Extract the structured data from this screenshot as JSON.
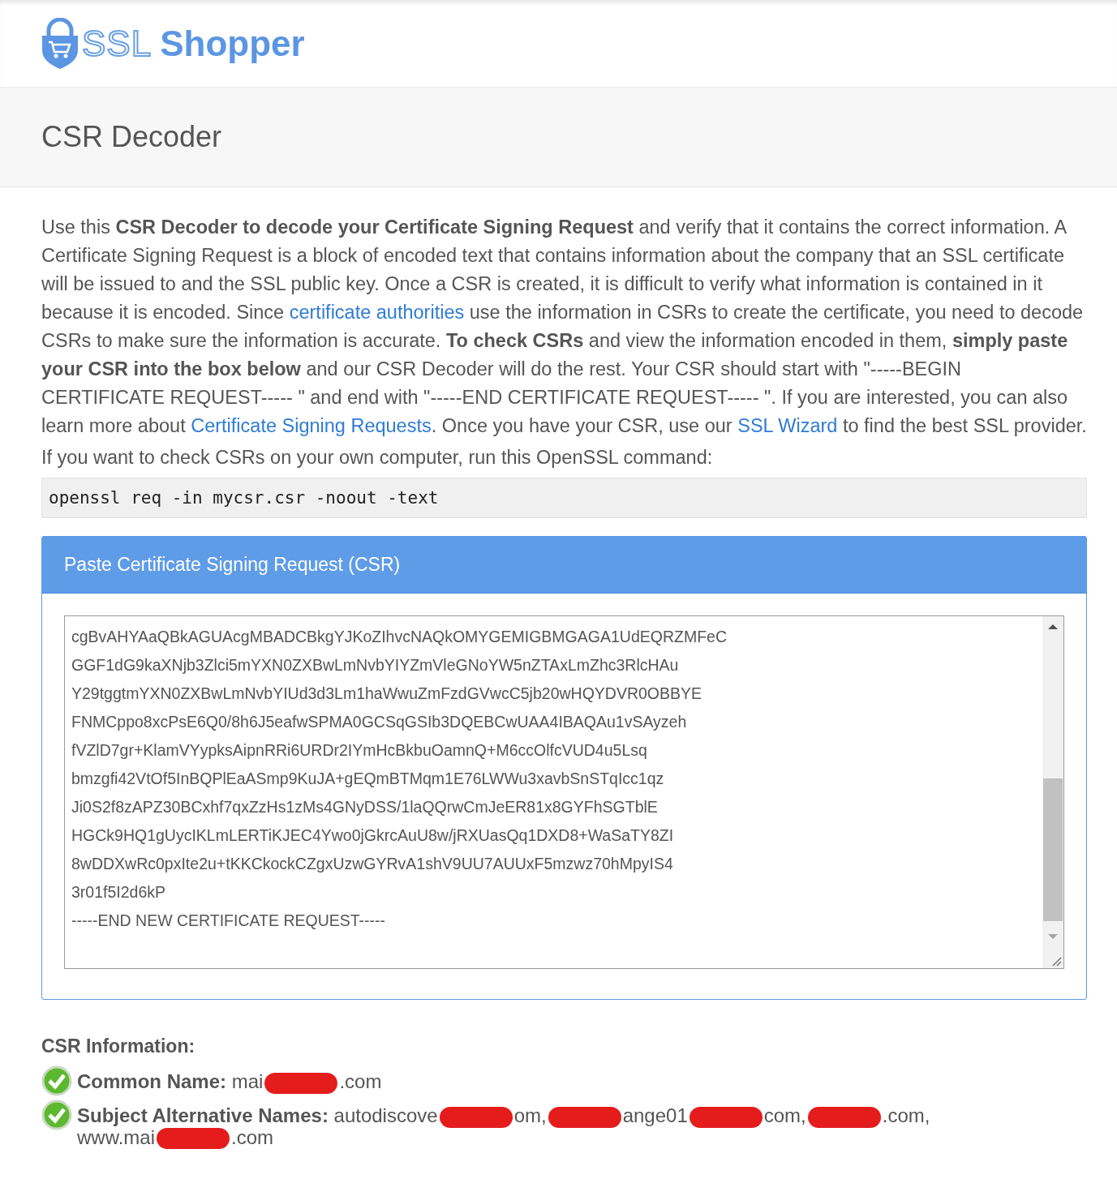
{
  "logo": {
    "outline_text": "SSL",
    "bold_text": "Shopper"
  },
  "page_title": "CSR Decoder",
  "intro": [
    {
      "kind": "text",
      "text": "Use this **CSR Decoder to decode your Certificate Signing Request** and verify that it contains the correct information. A Certificate Signing Request is a block of encoded text that contains information about the company that an SSL certificate will be issued to and the SSL public key. Once a CSR is created, it is difficult to verify what information is contained in it because it is encoded. Since "
    },
    {
      "kind": "link",
      "text": "certificate authorities"
    },
    {
      "kind": "text",
      "text": " use the information in CSRs to create the certificate, you need to decode CSRs to make sure the information is accurate. **To check CSRs** and view the information encoded in them, **simply paste your CSR into the box below** and our CSR Decoder will do the rest. Your CSR should start with \"-----BEGIN CERTIFICATE REQUEST----- \" and end with \"-----END CERTIFICATE REQUEST----- \". If you are interested, you can also learn more about "
    },
    {
      "kind": "link",
      "text": "Certificate Signing Requests"
    },
    {
      "kind": "text",
      "text": ". Once you have your CSR, use our "
    },
    {
      "kind": "link",
      "text": "SSL Wizard"
    },
    {
      "kind": "text",
      "text": " to find the best SSL provider."
    }
  ],
  "command_intro": "If you want to check CSRs on your own computer, run this OpenSSL command:",
  "command": "openssl req -in mycsr.csr -noout -text",
  "panel": {
    "title": "Paste Certificate Signing Request (CSR)",
    "csr_lines": [
      "cgBvAHYAaQBkAGUAcgMBADCBkgYJKoZIhvcNAQkOMYGEMIGBMGAGA1UdEQRZMFeC",
      "GGF1dG9kaXNjb3Zlci5mYXN0ZXBwLmNvbYIYZmVleGNoYW5nZTAxLmZhc3RlcHAu",
      "Y29tggtmYXN0ZXBwLmNvbYIUd3d3Lm1haWwuZmFzdGVwcC5jb20wHQYDVR0OBBYE",
      "FNMCppo8xcPsE6Q0/8h6J5eafwSPMA0GCSqGSIb3DQEBCwUAA4IBAQAu1vSAyzeh",
      "fVZlD7gr+KlamVYypksAipnRRi6URDr2IYmHcBkbuOamnQ+M6ccOlfcVUD4u5Lsq",
      "bmzgfi42VtOf5InBQPlEaASmp9KuJA+gEQmBTMqm1E76LWWu3xavbSnSTqIcc1qz",
      "Ji0S2f8zAPZ30BCxhf7qxZzHs1zMs4GNyDSS/1laQQrwCmJeER81x8GYFhSGTblE",
      "HGCk9HQ1gUycIKLmLERTiKJEC4Ywo0jGkrcAuU8w/jRXUasQq1DXD8+WaSaTY8ZI",
      "8wDDXwRc0pxIte2u+tKKCkockCZgxUzwGYRvA1shV9UU7AUUxF5mzwz70hMpyIS4",
      "3r01f5I2d6kP",
      "-----END NEW CERTIFICATE REQUEST-----"
    ]
  },
  "info_title": "CSR Information:",
  "info": [
    {
      "label": "Common Name:",
      "valid": true,
      "parts": [
        {
          "kind": "text",
          "text": "mai"
        },
        {
          "kind": "redacted"
        },
        {
          "kind": "text",
          "text": ".com"
        }
      ]
    },
    {
      "label": "Subject Alternative Names:",
      "valid": true,
      "parts": [
        {
          "kind": "text",
          "text": "autodiscove"
        },
        {
          "kind": "redacted"
        },
        {
          "kind": "text",
          "text": "om,"
        },
        {
          "kind": "redacted"
        },
        {
          "kind": "text",
          "text": "ange01"
        },
        {
          "kind": "redacted"
        },
        {
          "kind": "text",
          "text": "com,"
        },
        {
          "kind": "redacted"
        },
        {
          "kind": "text",
          "text": ".com,"
        },
        {
          "kind": "break"
        },
        {
          "kind": "text",
          "text": "www.mai"
        },
        {
          "kind": "redacted"
        },
        {
          "kind": "text",
          "text": ".com"
        }
      ]
    }
  ]
}
